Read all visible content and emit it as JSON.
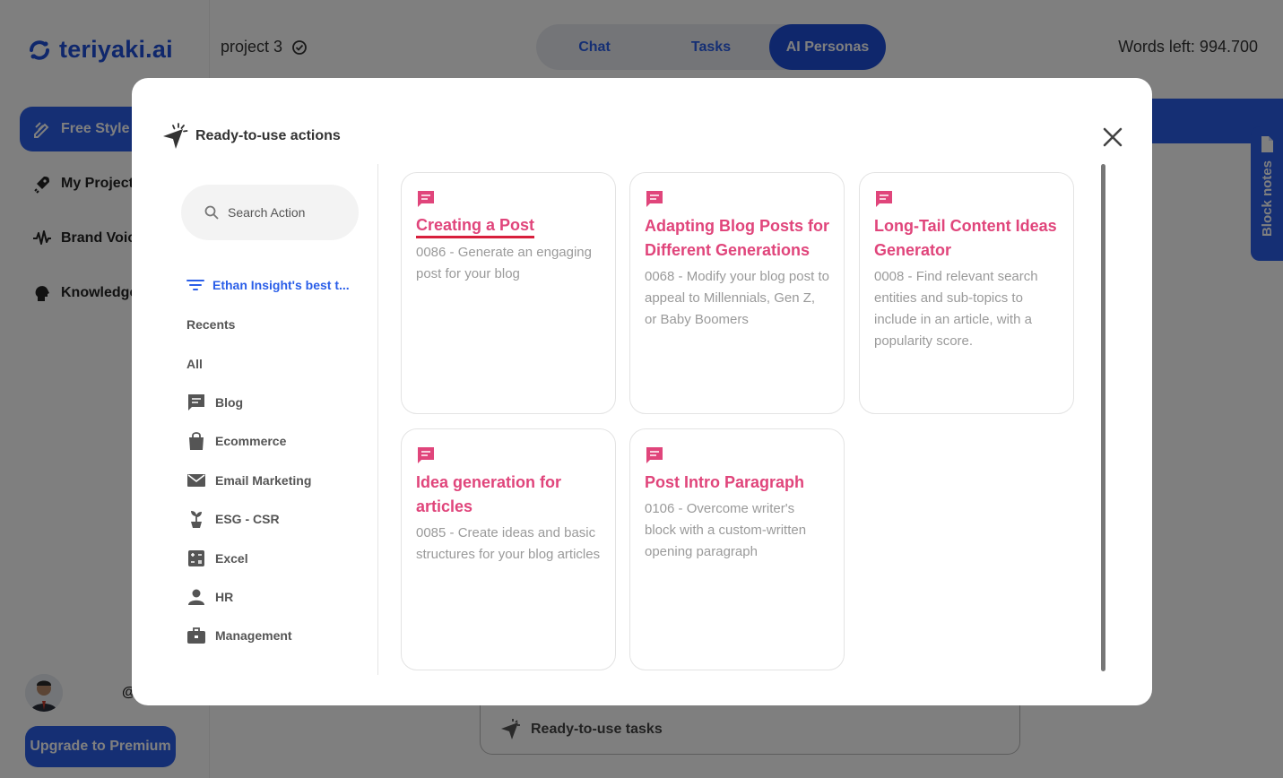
{
  "app": {
    "logo_text": "teriyaki.ai",
    "project_name": "project 3",
    "words_left": "Words left: 994.700",
    "brand_color": "#2a5ee8"
  },
  "sidebar": {
    "items": [
      {
        "label": "Free Style",
        "icon": "pen-icon",
        "active": true
      },
      {
        "label": "My Projects",
        "icon": "rocket-icon"
      },
      {
        "label": "Brand Voice",
        "icon": "waveform-icon"
      },
      {
        "label": "Knowledge",
        "icon": "head-icon"
      }
    ],
    "user_handle": "@",
    "upgrade_label": "Upgrade to Premium"
  },
  "tabs": [
    {
      "label": "Chat",
      "active": false
    },
    {
      "label": "Tasks",
      "active": false
    },
    {
      "label": "AI Personas",
      "active": true
    }
  ],
  "block_notes_label": "Block notes",
  "bottom_panel_label": "Ready-to-use tasks",
  "modal": {
    "title": "Ready-to-use actions",
    "search_placeholder": "Search Action",
    "filter_label": "Ethan Insight's best t...",
    "recents_label": "Recents",
    "all_label": "All",
    "categories": [
      {
        "label": "Blog",
        "icon": "chat-bubble-icon"
      },
      {
        "label": "Ecommerce",
        "icon": "shopping-bag-icon"
      },
      {
        "label": "Email Marketing",
        "icon": "envelope-icon"
      },
      {
        "label": "ESG - CSR",
        "icon": "plant-icon"
      },
      {
        "label": "Excel",
        "icon": "calculator-icon"
      },
      {
        "label": "HR",
        "icon": "person-icon"
      },
      {
        "label": "Management",
        "icon": "briefcase-icon"
      }
    ],
    "cards": [
      {
        "title": "Creating a Post",
        "description": "0086 - Generate an engaging post for your blog",
        "icon": "chat-bubble-icon"
      },
      {
        "title": "Adapting Blog Posts for Different Generations",
        "description": "0068 - Modify your blog post to appeal to Millennials, Gen Z, or Baby Boomers",
        "icon": "chat-bubble-icon"
      },
      {
        "title": "Long-Tail Content Ideas Generator",
        "description": "0008 - Find relevant search entities and sub-topics to include in an article, with a popularity score.",
        "icon": "chat-bubble-icon"
      },
      {
        "title": "Idea generation for articles",
        "description": "0085 - Create ideas and basic structures for your blog articles",
        "icon": "chat-bubble-icon"
      },
      {
        "title": "Post Intro Paragraph",
        "description": "0106 - Overcome writer's block with a custom-written opening paragraph",
        "icon": "chat-bubble-icon"
      }
    ],
    "card_title_color": "#e0457b"
  }
}
